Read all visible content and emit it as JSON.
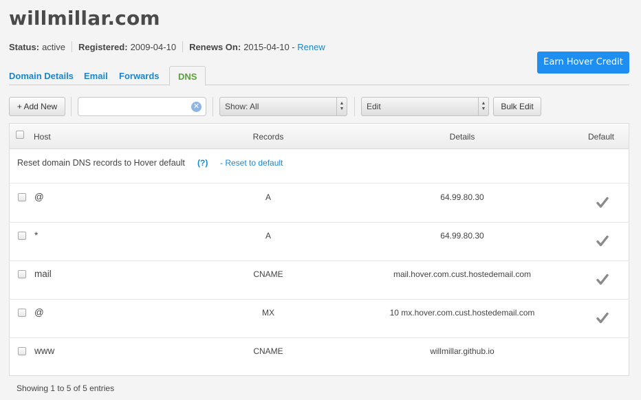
{
  "domain": {
    "title": "willmillar.com"
  },
  "status": {
    "status_label": "Status:",
    "status_value": "active",
    "registered_label": "Registered:",
    "registered_value": "2009-04-10",
    "renews_label": "Renews On:",
    "renews_value": "2015-04-10 -",
    "renew_link": "Renew"
  },
  "earn_button": "Earn Hover Credit",
  "tabs": [
    {
      "label": "Domain Details"
    },
    {
      "label": "Email"
    },
    {
      "label": "Forwards"
    },
    {
      "label": "DNS",
      "active": true
    }
  ],
  "toolbar": {
    "add_new": "+ Add New",
    "search_value": "",
    "show_select": "Show: All",
    "edit_select": "Edit",
    "bulk_edit": "Bulk Edit"
  },
  "table": {
    "headers": {
      "host": "Host",
      "records": "Records",
      "details": "Details",
      "default": "Default"
    },
    "reset": {
      "text": "Reset domain DNS records to Hover default",
      "help": "(?)",
      "link": "- Reset to default"
    },
    "rows": [
      {
        "host": "@",
        "record": "A",
        "details": "64.99.80.30",
        "default": true
      },
      {
        "host": "*",
        "record": "A",
        "details": "64.99.80.30",
        "default": true
      },
      {
        "host": "mail",
        "record": "CNAME",
        "details": "mail.hover.com.cust.hostedemail.com",
        "default": true
      },
      {
        "host": "@",
        "record": "MX",
        "details": "10 mx.hover.com.cust.hostedemail.com",
        "default": true
      },
      {
        "host": "www",
        "record": "CNAME",
        "details": "willmillar.github.io",
        "default": false
      }
    ]
  },
  "footer": {
    "entries_text": "Showing 1 to 5 of 5 entries"
  },
  "colors": {
    "link": "#1a86d0",
    "active_tab": "#59a13b",
    "primary_button": "#1e8ff0"
  }
}
